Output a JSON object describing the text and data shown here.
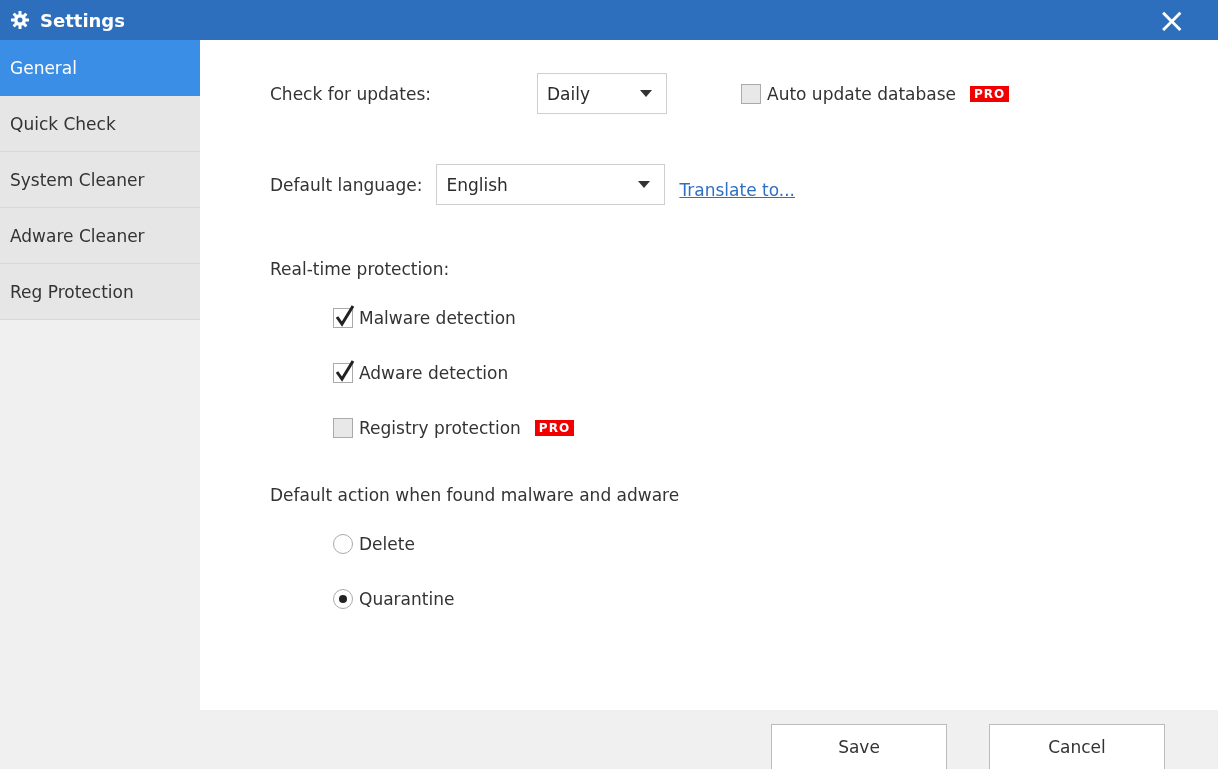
{
  "window": {
    "title": "Settings",
    "close": "×"
  },
  "sidebar": {
    "items": [
      {
        "label": "General",
        "selected": true
      },
      {
        "label": "Quick Check",
        "selected": false
      },
      {
        "label": "System Cleaner",
        "selected": false
      },
      {
        "label": "Adware Cleaner",
        "selected": false
      },
      {
        "label": "Reg Protection",
        "selected": false
      }
    ]
  },
  "updates": {
    "label": "Check for updates:",
    "value": "Daily"
  },
  "auto_update": {
    "label": "Auto update database",
    "checked": false,
    "badge": "PRO"
  },
  "language": {
    "label": "Default language:",
    "value": "English",
    "link": "Translate to..."
  },
  "realtime": {
    "heading": "Real-time protection:",
    "options": [
      {
        "label": "Malware detection",
        "checked": true
      },
      {
        "label": "Adware detection",
        "checked": true
      },
      {
        "label": "Registry protection",
        "checked": false,
        "badge": "PRO"
      }
    ]
  },
  "default_action": {
    "heading": "Default action when found malware and adware",
    "options": [
      {
        "label": "Delete",
        "selected": false
      },
      {
        "label": "Quarantine",
        "selected": true
      }
    ]
  },
  "buttons": [
    "Save",
    "Cancel"
  ]
}
